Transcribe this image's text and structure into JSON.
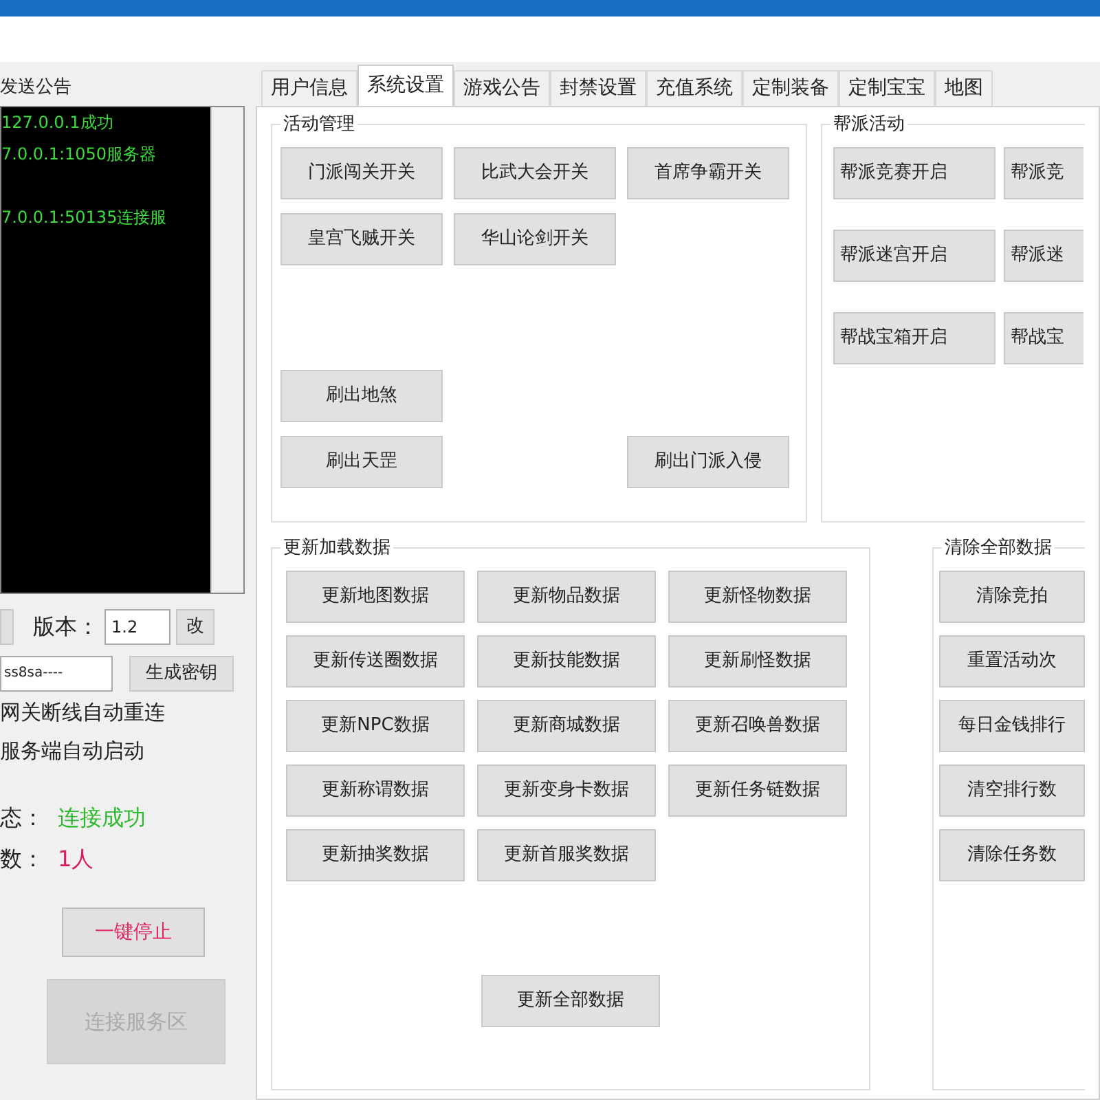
{
  "left_panel": {
    "title": "发送公告",
    "log": [
      "127.0.0.1成功",
      "7.0.0.1:1050服务器",
      "7.0.0.1:50135连接服"
    ],
    "version_label": "版本：",
    "version_value": "1.2",
    "change_button": "改",
    "key_value": "ss8sa----",
    "generate_key_button": "生成密钥",
    "options": [
      "网关断线自动重连",
      "服务端自动启动"
    ],
    "status_label": "态：",
    "status_value": "连接成功",
    "count_label": "数：",
    "count_value": "1人",
    "stop_button": {
      "label": "一键停止",
      "disabled": false
    },
    "connect_button": {
      "label": "连接服务区",
      "disabled": true
    }
  },
  "tabs": [
    {
      "label": "用户信息",
      "selected": false
    },
    {
      "label": "系统设置",
      "selected": true
    },
    {
      "label": "游戏公告",
      "selected": false
    },
    {
      "label": "封禁设置",
      "selected": false
    },
    {
      "label": "充值系统",
      "selected": false
    },
    {
      "label": "定制装备",
      "selected": false
    },
    {
      "label": "定制宝宝",
      "selected": false
    },
    {
      "label": "地图",
      "selected": false
    }
  ],
  "activity": {
    "title": "活动管理",
    "toggles": [
      "门派闯关开关",
      "比武大会开关",
      "首席争霸开关",
      "皇宫飞贼开关",
      "华山论剑开关"
    ],
    "spawns": [
      "刷出地煞",
      "刷出天罡",
      "刷出门派入侵"
    ]
  },
  "guild": {
    "title": "帮派活动",
    "rows": [
      [
        "帮派竞赛开启",
        "帮派竞"
      ],
      [
        "帮派迷宫开启",
        "帮派迷"
      ],
      [
        "帮战宝箱开启",
        "帮战宝"
      ]
    ]
  },
  "update": {
    "title": "更新加载数据",
    "buttons": [
      "更新地图数据",
      "更新物品数据",
      "更新怪物数据",
      "更新传送圈数据",
      "更新技能数据",
      "更新刷怪数据",
      "更新NPC数据",
      "更新商城数据",
      "更新召唤兽数据",
      "更新称谓数据",
      "更新变身卡数据",
      "更新任务链数据",
      "更新抽奖数据",
      "更新首服奖数据"
    ],
    "all_button": "更新全部数据"
  },
  "clear": {
    "title": "清除全部数据",
    "buttons": [
      "清除竞拍",
      "重置活动次",
      "每日金钱排行",
      "清空排行数",
      "清除任务数"
    ]
  }
}
